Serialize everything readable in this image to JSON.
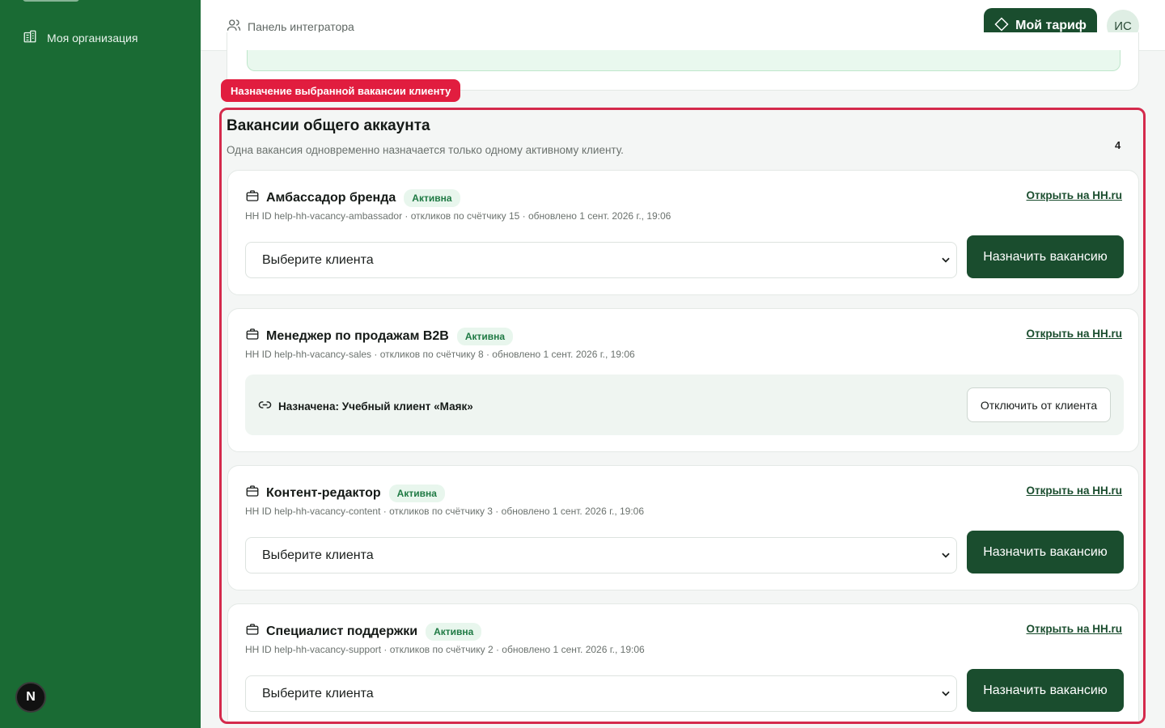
{
  "sidebar": {
    "items": [
      {
        "label": "Моя организация",
        "icon": "building-icon"
      }
    ],
    "footer_badge": "N"
  },
  "header": {
    "breadcrumb": "Панель интегратора",
    "tariff_button": "Мой тариф",
    "avatar_initials": "ИС"
  },
  "annotation": {
    "label": "Назначение выбранной вакансии клиенту",
    "color": "#e11d3f"
  },
  "section": {
    "title": "Вакансии общего аккаунта",
    "subtitle": "Одна вакансия одновременно назначается только одному активному клиенту.",
    "count": "4",
    "open_link": "Открыть на HH.ru",
    "select_placeholder": "Выберите клиента",
    "assign_button": "Назначить вакансию",
    "detach_button": "Отключить от клиента",
    "vacancies": [
      {
        "title": "Амбассадор бренда",
        "status": "Активна",
        "meta": "HH ID help-hh-vacancy-ambassador · откликов по счётчику 15 · обновлено 1 сент. 2026 г., 19:06"
      },
      {
        "title": "Менеджер по продажам B2B",
        "status": "Активна",
        "meta": "HH ID help-hh-vacancy-sales · откликов по счётчику 8 · обновлено 1 сент. 2026 г., 19:06",
        "assigned": "Назначена: Учебный клиент «Маяк»"
      },
      {
        "title": "Контент-редактор",
        "status": "Активна",
        "meta": "HH ID help-hh-vacancy-content · откликов по счётчику 3 · обновлено 1 сент. 2026 г., 19:06"
      },
      {
        "title": "Специалист поддержки",
        "status": "Активна",
        "meta": "HH ID help-hh-vacancy-support · откликов по счётчику 2 · обновлено 1 сент. 2026 г., 19:06"
      }
    ]
  },
  "colors": {
    "sidebar": "#1a6b34",
    "primary_button": "#1a4d2e",
    "highlight_border": "#d42a4c",
    "badge_text": "#1f7a44"
  }
}
